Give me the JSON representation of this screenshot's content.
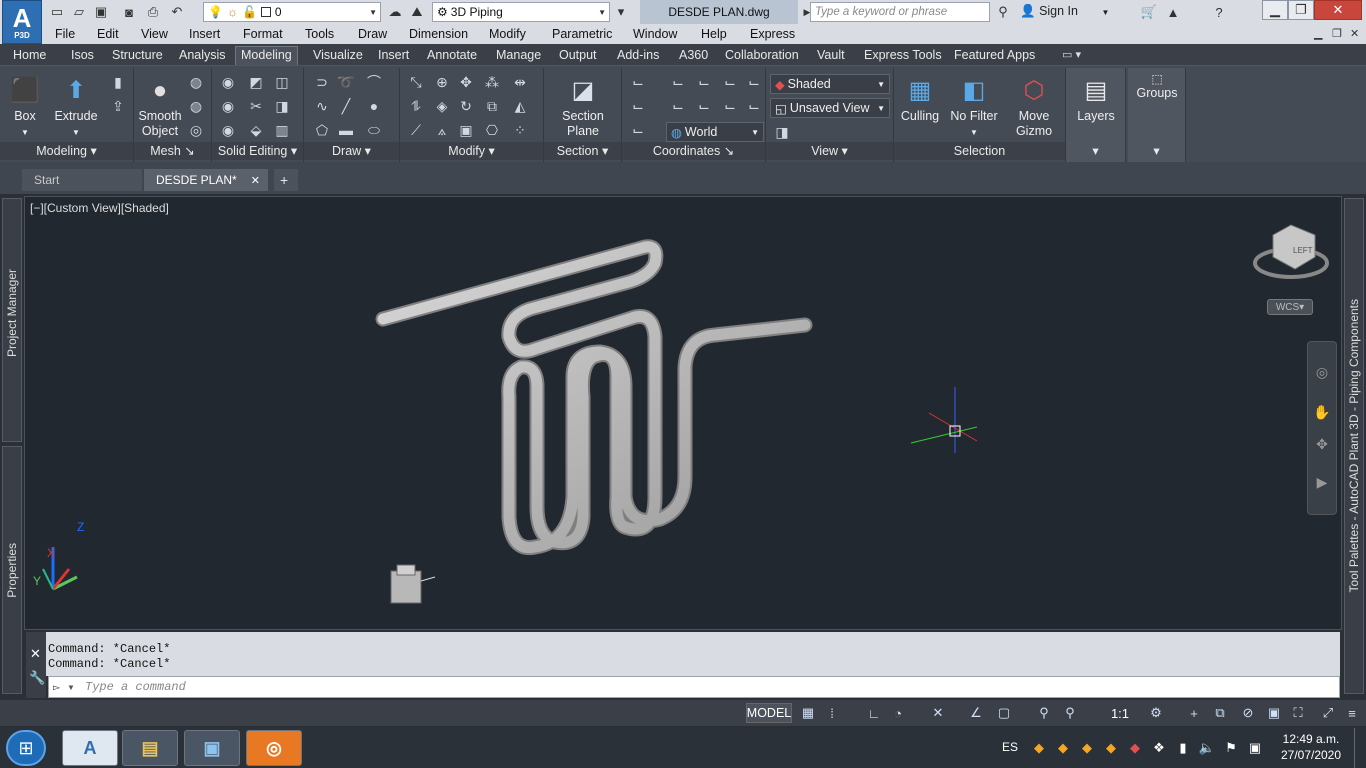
{
  "app": {
    "logo": "A",
    "logo_sub": "P3D"
  },
  "title_bar": {
    "layer_value": "0",
    "workspace": "3D Piping",
    "filename": "DESDE PLAN.dwg",
    "search_placeholder": "Type a keyword or phrase",
    "sign_in": "Sign In"
  },
  "menu": [
    "File",
    "Edit",
    "View",
    "Insert",
    "Format",
    "Tools",
    "Draw",
    "Dimension",
    "Modify",
    "Parametric",
    "Window",
    "Help",
    "Express"
  ],
  "ribbon_tabs": [
    "Home",
    "Isos",
    "Structure",
    "Analysis",
    "Modeling",
    "Visualize",
    "Insert",
    "Annotate",
    "Manage",
    "Output",
    "Add-ins",
    "A360",
    "Collaboration",
    "Vault",
    "Express Tools",
    "Featured Apps"
  ],
  "active_tab": "Modeling",
  "ribbon": {
    "modeling_title": "Modeling",
    "box": "Box",
    "extrude": "Extrude",
    "smooth_object": "Smooth Object",
    "mesh_title": "Mesh",
    "solid_editing_title": "Solid Editing",
    "draw_title": "Draw",
    "modify_title": "Modify",
    "section_plane": "Section Plane",
    "section_title": "Section",
    "coordinates_title": "Coordinates",
    "world": "World",
    "visual_style": "Shaded",
    "view_name": "Unsaved View",
    "view_title": "View",
    "culling": "Culling",
    "no_filter": "No Filter",
    "move_gizmo": "Move Gizmo",
    "selection_title": "Selection",
    "layers": "Layers",
    "groups": "Groups"
  },
  "doc_tabs": {
    "start": "Start",
    "current": "DESDE PLAN*"
  },
  "viewport": {
    "label": "[−][Custom View][Shaded]",
    "wcs": "WCS",
    "cube_face": "LEFT"
  },
  "side": {
    "project_manager": "Project Manager",
    "properties": "Properties",
    "tool_palettes": "Tool Palettes - AutoCAD Plant 3D - Piping Components"
  },
  "command": {
    "history": [
      "Command: *Cancel*",
      "Command: *Cancel*"
    ],
    "placeholder": "Type a command"
  },
  "status": {
    "model": "MODEL",
    "scale": "1:1"
  },
  "taskbar": {
    "lang": "ES",
    "time": "12:49 a.m.",
    "date": "27/07/2020"
  }
}
